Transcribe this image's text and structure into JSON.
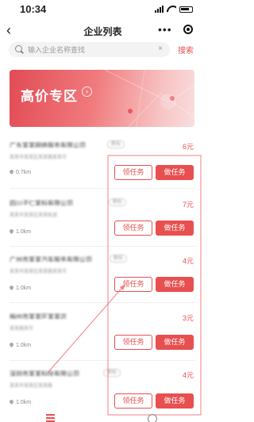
{
  "status_bar": {
    "time": "10:34"
  },
  "nav": {
    "back_symbol": "‹",
    "title": "企业列表",
    "more_symbol": "•••"
  },
  "search": {
    "placeholder": "输入企业名称查找",
    "clear_symbol": "×",
    "button_label": "搜索"
  },
  "banner": {
    "title": "高价专区",
    "arrow_symbol": "›"
  },
  "colors": {
    "accent": "#e84f4f",
    "annotation": "#f08080"
  },
  "list": {
    "items": [
      {
        "name": "广东某某网络服务有限公司",
        "tag": "新标",
        "price": "6元",
        "sub": "某某市某某区某某路某某号",
        "distance": "0.7km",
        "claim_label": "领任务",
        "do_label": "做任务"
      },
      {
        "name": "四川子仁某科有限公司",
        "tag": "新标",
        "price": "7元",
        "sub": "某某市某某区某某街道",
        "distance": "1.0km",
        "claim_label": "领任务",
        "do_label": "做任务"
      },
      {
        "name": "广州市某某汽车服务有限公司",
        "tag": "新标",
        "price": "4元",
        "sub": "某某市某某区某某路某某号",
        "distance": "1.0km",
        "claim_label": "领任务",
        "do_label": "做任务"
      },
      {
        "name": "梅州市某某区某某店",
        "tag": "",
        "price": "3元",
        "sub": "某某路某号",
        "distance": "1.0km",
        "claim_label": "领任务",
        "do_label": "做任务"
      },
      {
        "name": "深圳市某某科技有限公司",
        "tag": "新标",
        "price": "4元",
        "sub": "某某市某某区某某路",
        "distance": "1.0km",
        "claim_label": "领任务",
        "do_label": "做任务"
      }
    ]
  }
}
